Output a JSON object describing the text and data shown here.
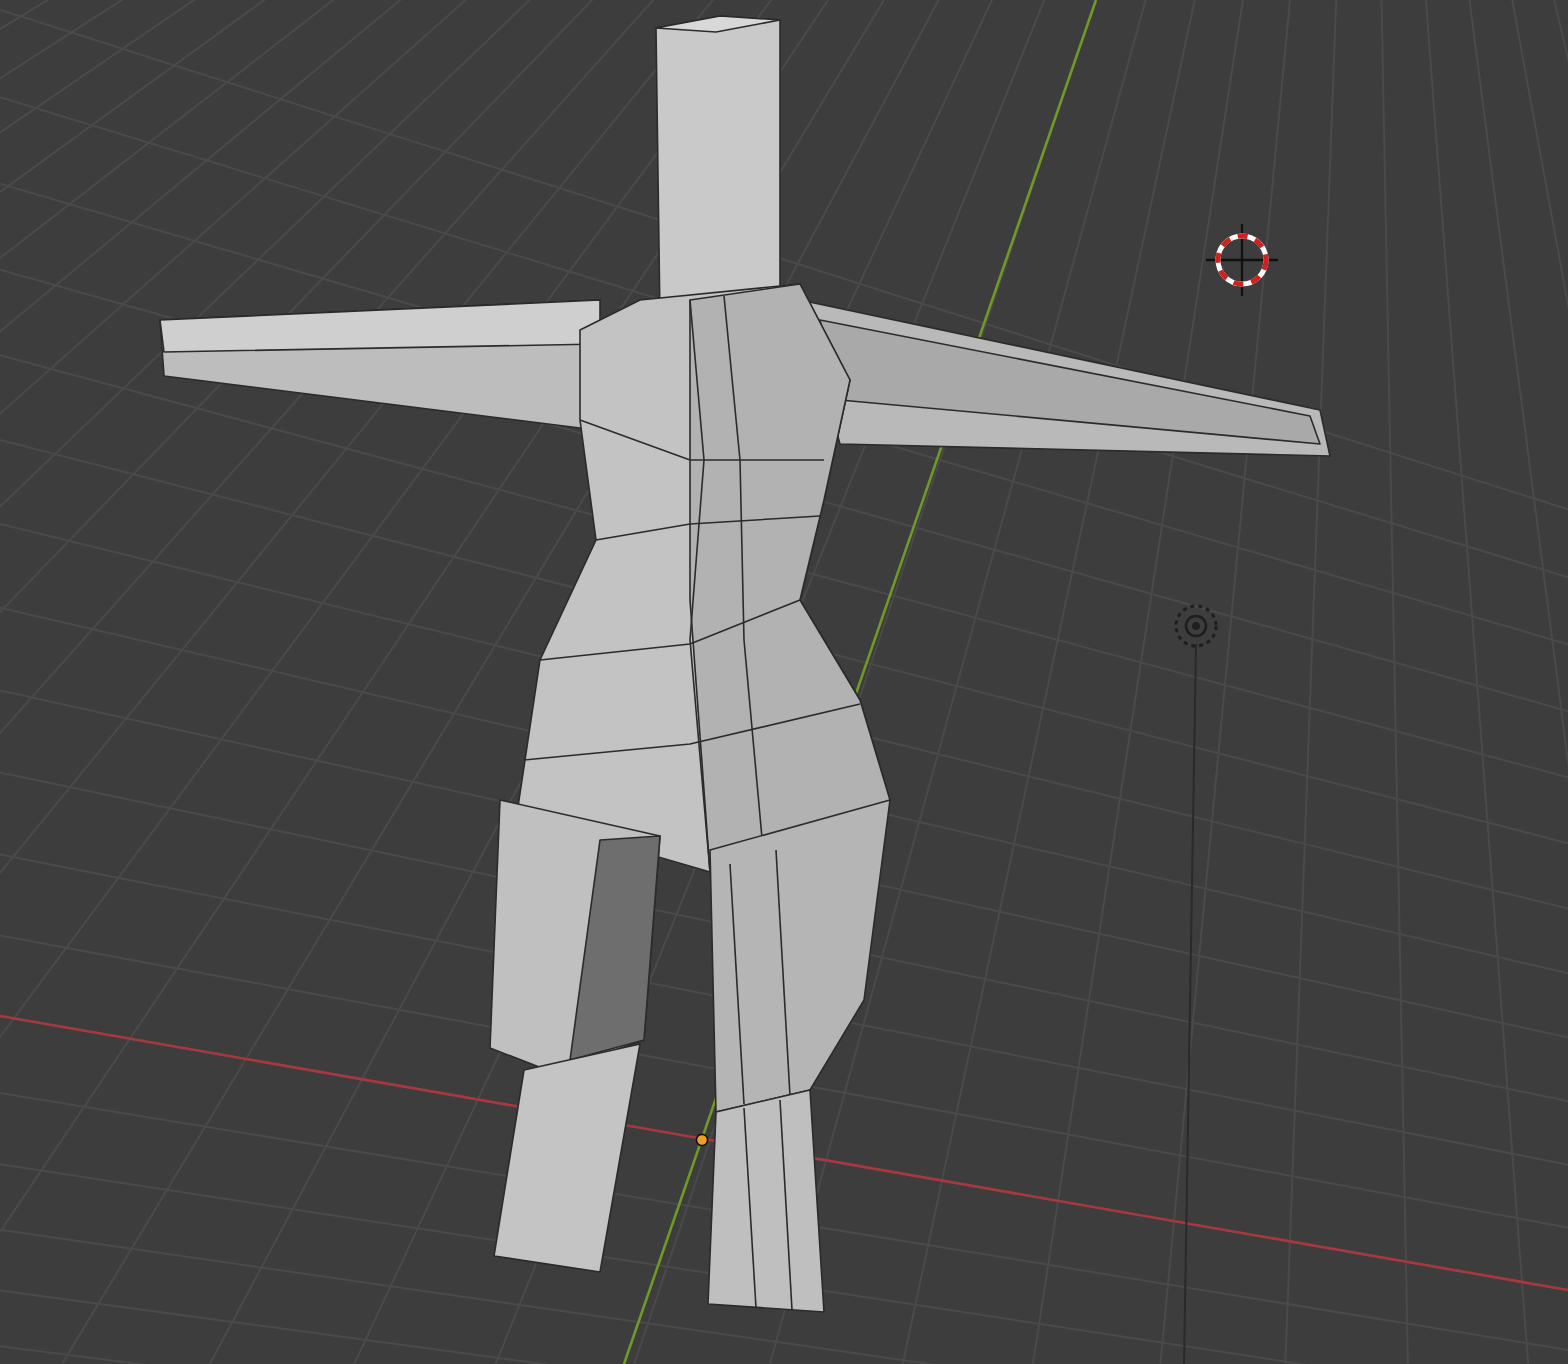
{
  "viewport": {
    "show_grid": true,
    "show_axes": true,
    "show_cursor": true,
    "show_origin": true
  }
}
